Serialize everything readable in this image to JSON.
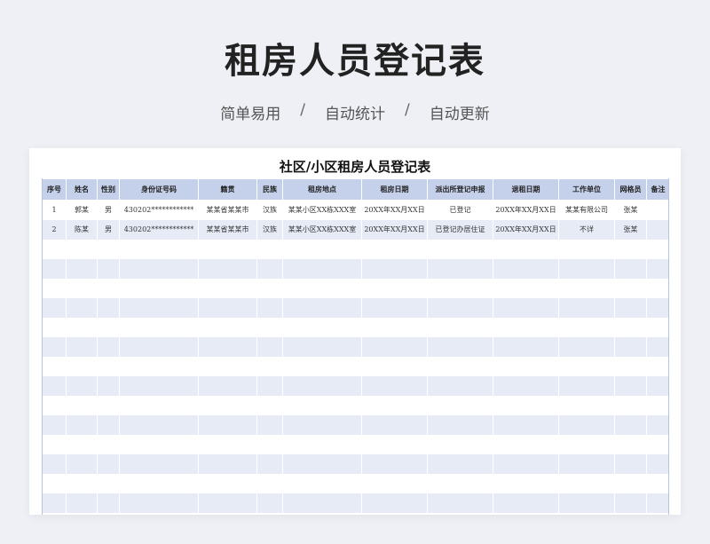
{
  "header": {
    "title": "租房人员登记表",
    "features": [
      "简单易用",
      "自动统计",
      "自动更新"
    ],
    "separator": "/"
  },
  "sheet": {
    "title": "社区/小区租房人员登记表",
    "columns": [
      "序号",
      "姓名",
      "性别",
      "身份证号码",
      "籍贯",
      "民族",
      "租房地点",
      "租房日期",
      "派出所登记申报",
      "退租日期",
      "工作单位",
      "网格员",
      "备注"
    ],
    "rows": [
      [
        "1",
        "郭某",
        "男",
        "430202************",
        "某某省某某市",
        "汉族",
        "某某小区XX栋XXX室",
        "20XX年XX月XX日",
        "已登记",
        "20XX年XX月XX日",
        "某某有限公司",
        "张某",
        ""
      ],
      [
        "2",
        "陈某",
        "男",
        "430202************",
        "某某省某某市",
        "汉族",
        "某某小区XX栋XXX室",
        "20XX年XX月XX日",
        "已登记办居住证",
        "20XX年XX月XX日",
        "不详",
        "张某",
        ""
      ]
    ],
    "empty_rows": 14
  },
  "colors": {
    "header_bg": "#c5d1ea",
    "stripe": "#e6ebf6",
    "page_bg": "#eef0f5"
  }
}
